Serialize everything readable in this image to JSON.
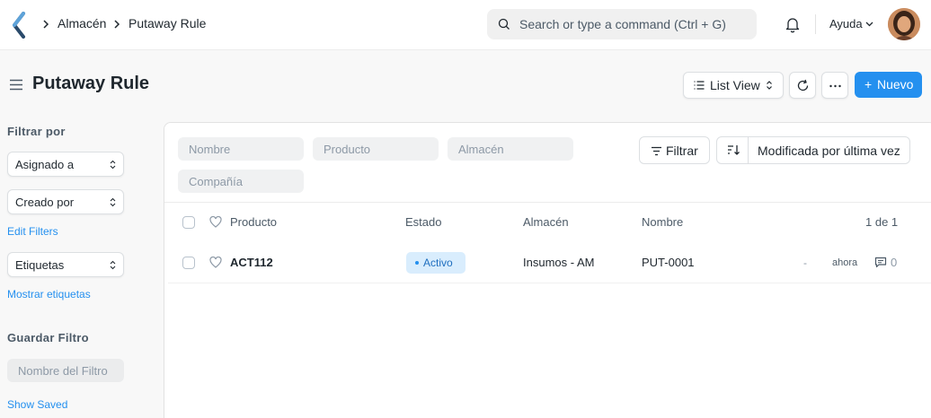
{
  "navbar": {
    "breadcrumbs": [
      "Almacén",
      "Putaway Rule"
    ],
    "search_placeholder": "Search or type a command (Ctrl + G)",
    "help_label": "Ayuda"
  },
  "page": {
    "title": "Putaway Rule",
    "view_label": "List View",
    "new_button_label": "Nuevo"
  },
  "sidebar": {
    "filter_heading": "Filtrar por",
    "assigned_to": "Asignado a",
    "created_by": "Creado por",
    "edit_filters": "Edit Filters",
    "tags": "Etiquetas",
    "show_tags": "Mostrar etiquetas",
    "save_filter_heading": "Guardar Filtro",
    "filter_name_placeholder": "Nombre del Filtro",
    "show_saved": "Show Saved"
  },
  "filters": {
    "nombre": "Nombre",
    "producto": "Producto",
    "almacen": "Almacén",
    "compania": "Compañía",
    "filter_button": "Filtrar",
    "sort_label": "Modificada por última vez"
  },
  "list": {
    "columns": [
      "Producto",
      "Estado",
      "Almacén",
      "Nombre"
    ],
    "count": "1 de 1",
    "rows": [
      {
        "producto": "ACT112",
        "estado": "Activo",
        "almacen": "Insumos - AM",
        "nombre": "PUT-0001",
        "dash": "-",
        "modified": "ahora",
        "comments": "0"
      }
    ]
  },
  "colors": {
    "primary": "#2490ef",
    "status_bg": "#d9edfd"
  }
}
